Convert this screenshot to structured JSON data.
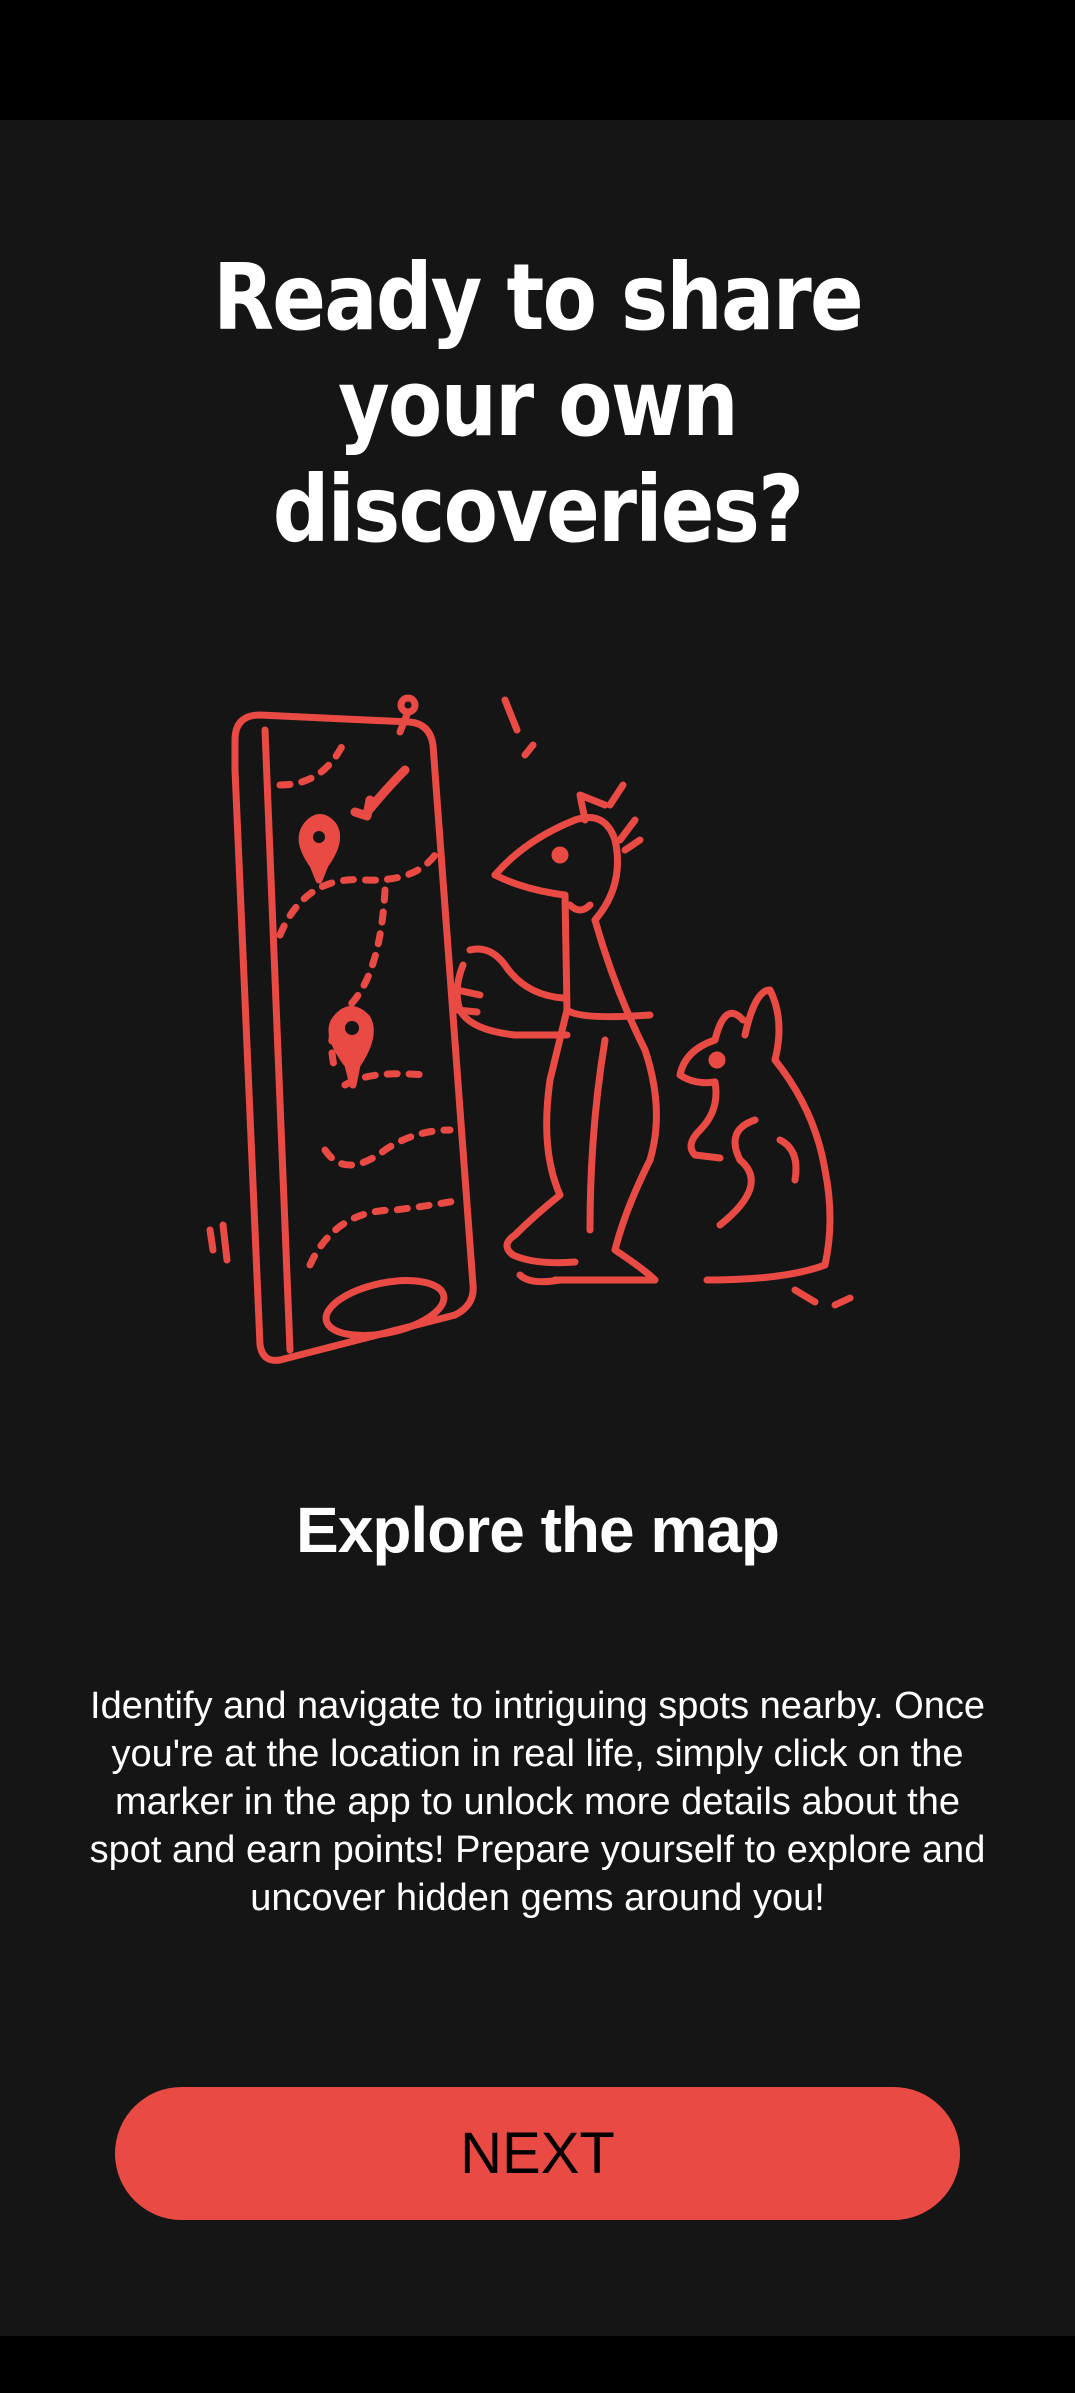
{
  "onboarding": {
    "headline_lines": [
      "Ready to share",
      "your own",
      "discoveries?"
    ],
    "illustration_icon": "phone-map-explorer-illustration",
    "subtitle": "Explore the map",
    "description": "Identify and navigate to intriguing spots nearby. Once you're at the location in real life, simply click on the marker in the app to unlock more details about the spot and earn points! Prepare yourself to explore and uncover hidden gems around you!",
    "next_label": "NEXT"
  },
  "colors": {
    "background": "#151515",
    "accent": "#e94b44",
    "text": "#ffffff"
  }
}
